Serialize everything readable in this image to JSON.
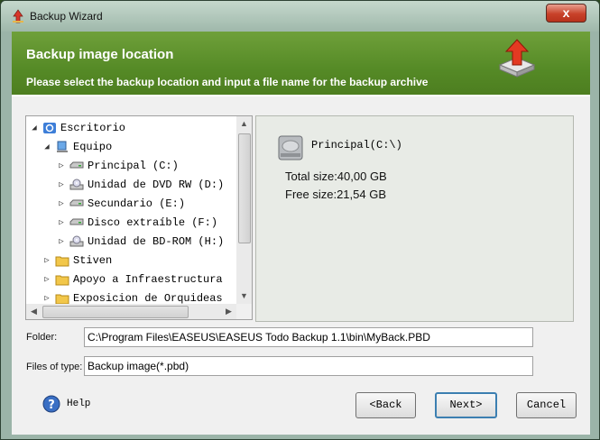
{
  "window": {
    "title": "Backup Wizard",
    "close_glyph": "x"
  },
  "banner": {
    "title": "Backup image location",
    "subtitle": "Please select the backup location and input a file name for the backup archive",
    "icon": "upload-disk-icon"
  },
  "tree": {
    "root": "Escritorio",
    "computer": "Equipo",
    "drives": [
      {
        "label": "Principal (C:)",
        "icon": "hard-drive-icon"
      },
      {
        "label": "Unidad de DVD RW (D:)",
        "icon": "optical-drive-icon"
      },
      {
        "label": "Secundario (E:)",
        "icon": "hard-drive-icon"
      },
      {
        "label": "Disco extraíble (F:)",
        "icon": "hard-drive-icon"
      },
      {
        "label": "Unidad de BD-ROM (H:)",
        "icon": "optical-drive-icon"
      }
    ],
    "folders": [
      {
        "label": "Stiven"
      },
      {
        "label": "Apoyo a Infraestructura"
      },
      {
        "label": "Exposicion de Orquideas"
      }
    ]
  },
  "info": {
    "drive_name": "Principal(C:\\)",
    "total_size": "Total size:40,00 GB",
    "free_size": "Free size:21,54 GB"
  },
  "form": {
    "folder_label": "Folder:",
    "folder_value": "C:\\Program Files\\EASEUS\\EASEUS Todo Backup 1.1\\bin\\MyBack.PBD",
    "type_label": "Files of type:",
    "type_value": "Backup image(*.pbd)"
  },
  "buttons": {
    "help": "Help",
    "back": "<Back",
    "next": "Next>",
    "cancel": "Cancel"
  },
  "colors": {
    "banner_green": "#558a26",
    "default_button_border": "#3c7fb1"
  }
}
